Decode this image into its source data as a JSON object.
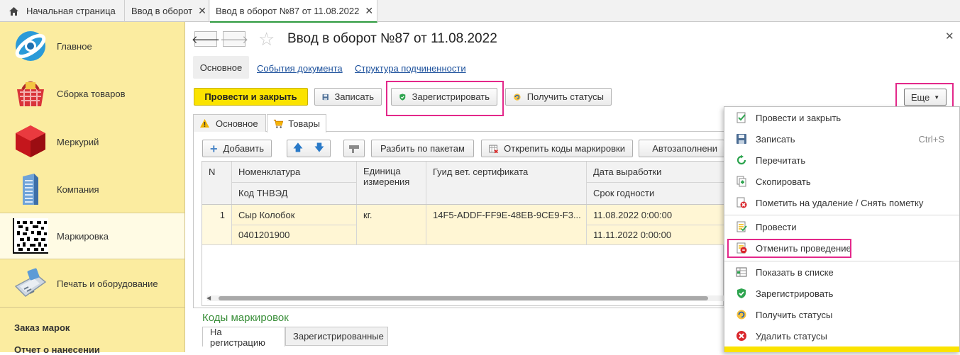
{
  "tabs": [
    {
      "label": "Начальная страница"
    },
    {
      "label": "Ввод в оборот"
    },
    {
      "label": "Ввод в оборот №87 от 11.08.2022"
    }
  ],
  "sidebar": {
    "items": [
      {
        "label": "Главное"
      },
      {
        "label": "Сборка товаров"
      },
      {
        "label": "Меркурий"
      },
      {
        "label": "Компания"
      },
      {
        "label": "Маркировка"
      },
      {
        "label": "Печать и оборудование"
      }
    ],
    "links": [
      "Заказ марок",
      "Отчет о нанесении"
    ]
  },
  "document": {
    "title": "Ввод в оборот №87 от 11.08.2022",
    "subnav": [
      "Основное",
      "События документа",
      "Структура подчиненности"
    ]
  },
  "toolbar": {
    "post_close": "Провести и закрыть",
    "save": "Записать",
    "register": "Зарегистрировать",
    "get_status": "Получить статусы",
    "more": "Еще"
  },
  "inner_tabs": [
    "Основное",
    "Товары"
  ],
  "goods_toolbar": {
    "add": "Добавить",
    "split": "Разбить по пакетам",
    "unpin": "Открепить коды маркировки",
    "autofill": "Автозаполнени"
  },
  "table": {
    "headers": {
      "n": "N",
      "nomenclature": "Номенклатура",
      "tnved": "Код ТНВЭД",
      "unit": "Единица измерения",
      "guid": "Гуид вет. сертификата",
      "prod_date": "Дата выработки",
      "expiry": "Срок годности"
    },
    "rows": [
      {
        "n": "1",
        "nomenclature": "Сыр Колобок",
        "tnved": "0401201900",
        "unit": "кг.",
        "guid": "14F5-ADDF-FF9E-48EB-9CE9-F3...",
        "prod_date": "11.08.2022 0:00:00",
        "expiry": "11.11.2022 0:00:00"
      }
    ]
  },
  "codes": {
    "title": "Коды маркировок",
    "tabs": [
      "На регистрацию",
      "Зарегистрированные"
    ]
  },
  "menu": {
    "items": [
      {
        "label": "Провести и закрыть",
        "icon": "post-close-icon"
      },
      {
        "label": "Записать",
        "shortcut": "Ctrl+S",
        "icon": "save-icon"
      },
      {
        "label": "Перечитать",
        "icon": "reload-icon"
      },
      {
        "label": "Скопировать",
        "icon": "copy-icon"
      },
      {
        "label": "Пометить на удаление / Снять пометку",
        "icon": "mark-delete-icon"
      },
      {
        "label": "Провести",
        "icon": "post-icon"
      },
      {
        "label": "Отменить проведение",
        "icon": "unpost-icon"
      },
      {
        "label": "Показать в списке",
        "icon": "show-list-icon"
      },
      {
        "label": "Зарегистрировать",
        "icon": "shield-icon"
      },
      {
        "label": "Получить статусы",
        "icon": "refresh-status-icon"
      },
      {
        "label": "Удалить статусы",
        "icon": "delete-status-icon"
      }
    ]
  },
  "colors": {
    "sidebar_bg": "#fbeca0",
    "primary_button": "#fbe300",
    "highlight": "#e3288a",
    "link": "#1a4f9b",
    "section_title": "#3a8f3a"
  }
}
